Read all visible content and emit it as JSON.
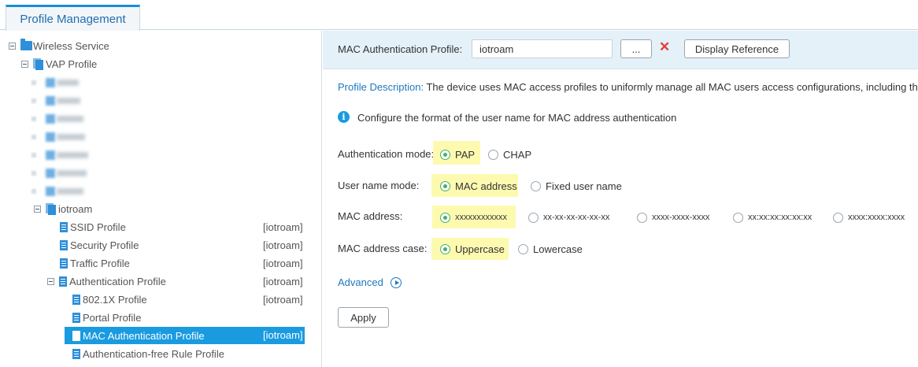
{
  "tabs": [
    {
      "label": "Profile Management"
    }
  ],
  "tree": {
    "root": "Wireless Service",
    "vap": "VAP Profile",
    "group": "iotroam",
    "children": [
      {
        "label": "SSID Profile",
        "tag": "[iotroam]"
      },
      {
        "label": "Security Profile",
        "tag": "[iotroam]"
      },
      {
        "label": "Traffic Profile",
        "tag": "[iotroam]"
      },
      {
        "label": "Authentication Profile",
        "tag": "[iotroam]"
      }
    ],
    "auth_children": [
      {
        "label": "802.1X Profile",
        "tag": "[iotroam]"
      },
      {
        "label": "Portal Profile",
        "tag": ""
      },
      {
        "label": "MAC Authentication Profile",
        "tag": "[iotroam]"
      },
      {
        "label": "Authentication-free Rule Profile",
        "tag": ""
      }
    ]
  },
  "topbar": {
    "label": "MAC Authentication Profile:",
    "value": "iotroam",
    "browse_label": "...",
    "delete_icon": "close-icon",
    "reference_label": "Display Reference"
  },
  "description": {
    "label": "Profile Description:",
    "text": " The device uses MAC access profiles to uniformly manage all MAC users access configurations, including the"
  },
  "info": {
    "text": "Configure the format of the user name for MAC address authentication"
  },
  "form": {
    "auth_mode": {
      "label": "Authentication mode:",
      "options": [
        "PAP",
        "CHAP"
      ],
      "selected": "PAP"
    },
    "username_mode": {
      "label": "User name mode:",
      "options": [
        "MAC address",
        "Fixed user name"
      ],
      "selected": "MAC address"
    },
    "mac_address": {
      "label": "MAC address:",
      "options": [
        "xxxxxxxxxxxx",
        "xx-xx-xx-xx-xx-xx",
        "xxxx-xxxx-xxxx",
        "xx:xx:xx:xx:xx:xx",
        "xxxx:xxxx:xxxx"
      ],
      "selected": "xxxxxxxxxxxx"
    },
    "mac_case": {
      "label": "MAC address case:",
      "options": [
        "Uppercase",
        "Lowercase"
      ],
      "selected": "Uppercase"
    }
  },
  "advanced_label": "Advanced",
  "apply_label": "Apply",
  "colors": {
    "accent": "#1a9be0",
    "highlight": "#fdfab0",
    "radio_checked": "#45b06a",
    "delete": "#e63b3b"
  }
}
